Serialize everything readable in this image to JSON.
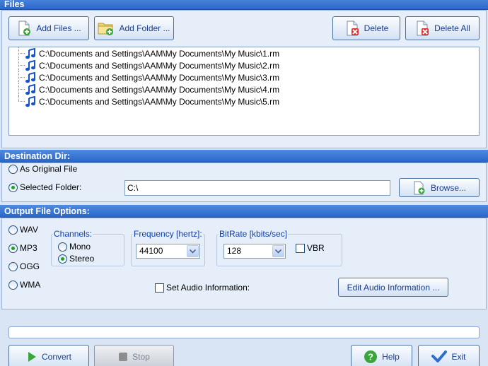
{
  "files_section": {
    "title": "Files",
    "add_files_label": "Add Files ...",
    "add_folder_label": "Add Folder ...",
    "delete_label": "Delete",
    "delete_all_label": "Delete All",
    "files": [
      "C:\\Documents and Settings\\AAM\\My Documents\\My Music\\1.rm",
      "C:\\Documents and Settings\\AAM\\My Documents\\My Music\\2.rm",
      "C:\\Documents and Settings\\AAM\\My Documents\\My Music\\3.rm",
      "C:\\Documents and Settings\\AAM\\My Documents\\My Music\\4.rm",
      "C:\\Documents and Settings\\AAM\\My Documents\\My Music\\5.rm"
    ]
  },
  "destination": {
    "title": "Destination Dir:",
    "as_original_label": "As Original File",
    "selected_folder_label": "Selected Folder:",
    "folder_value": "C:\\",
    "browse_label": "Browse...",
    "selected": "selected_folder"
  },
  "output": {
    "title": "Output File Options:",
    "formats": [
      "WAV",
      "MP3",
      "OGG",
      "WMA"
    ],
    "selected_format": "MP3",
    "channels_legend": "Channels:",
    "mono_label": "Mono",
    "stereo_label": "Stereo",
    "selected_channel": "Stereo",
    "frequency_legend": "Frequency [hertz]:",
    "frequency_value": "44100",
    "bitrate_legend": "BitRate [kbits/sec]",
    "bitrate_value": "128",
    "vbr_label": "VBR",
    "vbr_checked": false,
    "set_audio_info_label": "Set Audio Information:",
    "set_audio_info_checked": false,
    "edit_audio_info_label": "Edit Audio Information ..."
  },
  "progress": {
    "value": 0
  },
  "bottom_buttons": {
    "convert_label": "Convert",
    "stop_label": "Stop",
    "help_label": "Help",
    "exit_label": "Exit"
  },
  "colors": {
    "section_bar": "#2a66c8",
    "panel_bg": "#e6eef9",
    "legend_text": "#0b3fb0",
    "button_text": "#1a3e8c"
  }
}
